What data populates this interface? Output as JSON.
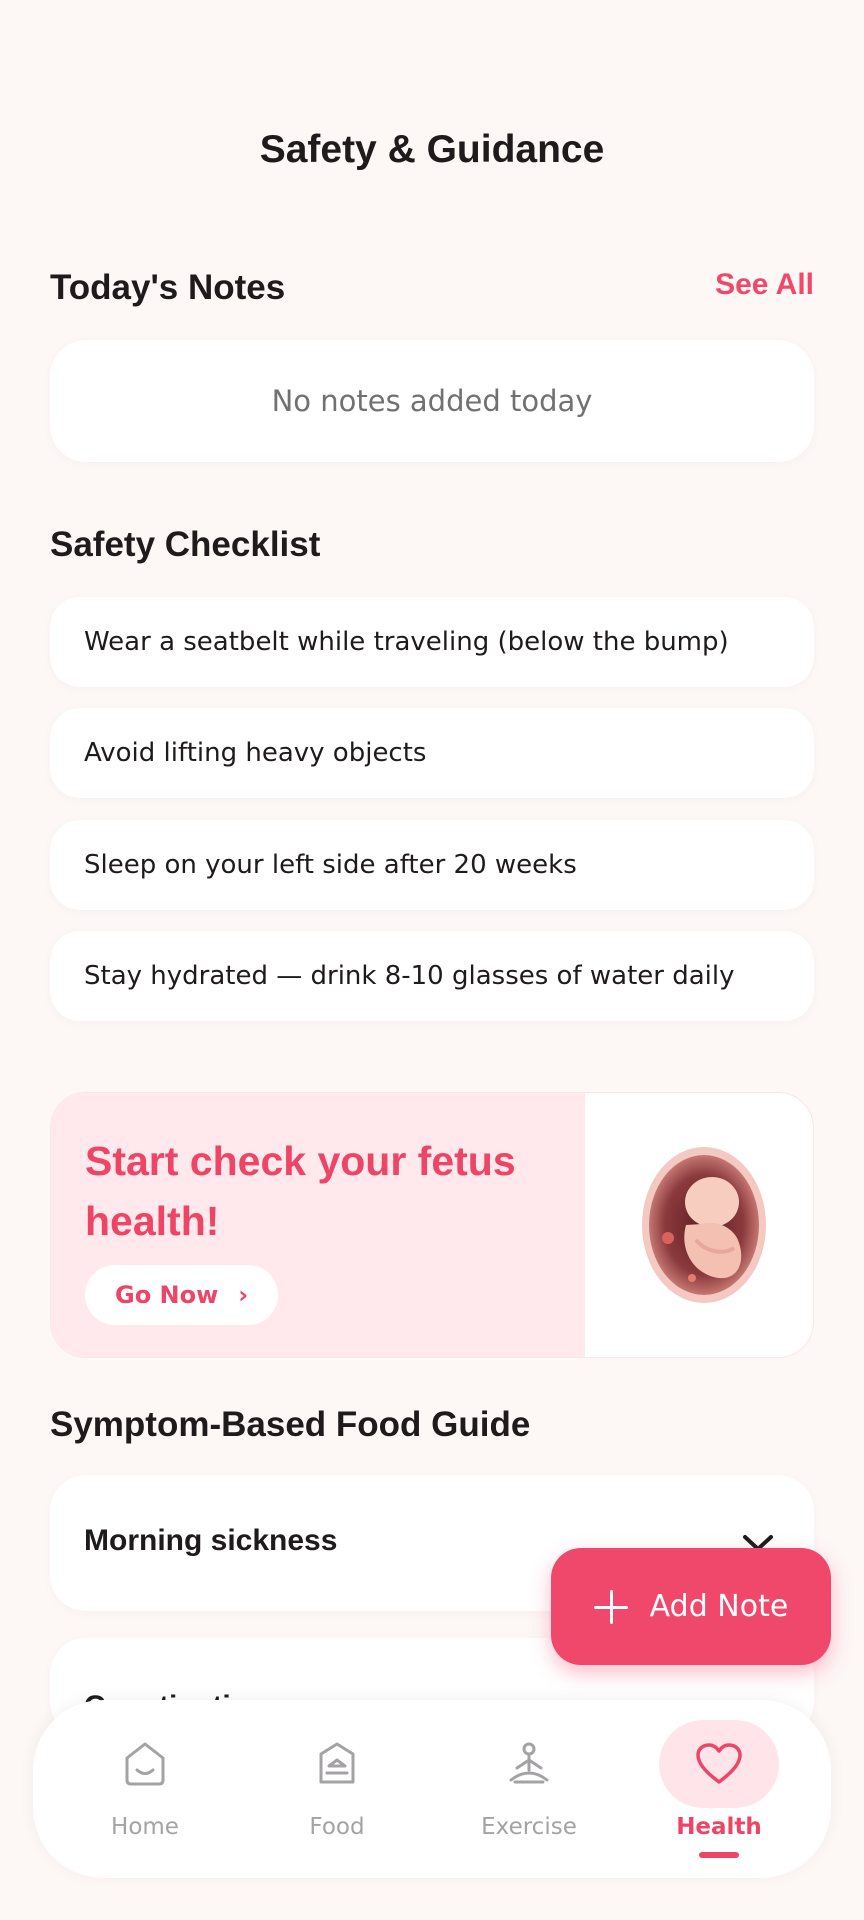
{
  "header": {
    "title": "Safety & Guidance"
  },
  "notes": {
    "title": "Today's Notes",
    "see_all_label": "See All",
    "empty_text": "No notes added today"
  },
  "checklist": {
    "title": "Safety Checklist",
    "items": [
      {
        "label": "Wear a seatbelt while traveling (below the bump)"
      },
      {
        "label": "Avoid lifting heavy objects"
      },
      {
        "label": "Sleep on your left side after 20 weeks"
      },
      {
        "label": "Stay hydrated — drink 8-10 glasses of water daily"
      }
    ]
  },
  "promo": {
    "title": "Start check your fetus health!",
    "button_label": "Go Now",
    "button_chevron": "›",
    "image_icon": "fetus-illustration"
  },
  "food_guide": {
    "title": "Symptom-Based Food Guide",
    "items": [
      {
        "label": "Morning sickness",
        "icon": "chevron-down-icon"
      },
      {
        "label": "Constipation",
        "icon": "chevron-down-icon"
      }
    ]
  },
  "fab": {
    "label": "Add Note",
    "icon": "plus-icon"
  },
  "bottom_nav": {
    "items": [
      {
        "label": "Home",
        "icon": "home-icon",
        "active": false
      },
      {
        "label": "Food",
        "icon": "food-icon",
        "active": false
      },
      {
        "label": "Exercise",
        "icon": "meditation-icon",
        "active": false
      },
      {
        "label": "Health",
        "icon": "heart-icon",
        "active": true
      }
    ]
  },
  "colors": {
    "accent": "#ee4466",
    "background": "#fdf7f6",
    "promo_background": "#ffe9ec",
    "inactive_nav": "#a4a2a4"
  }
}
